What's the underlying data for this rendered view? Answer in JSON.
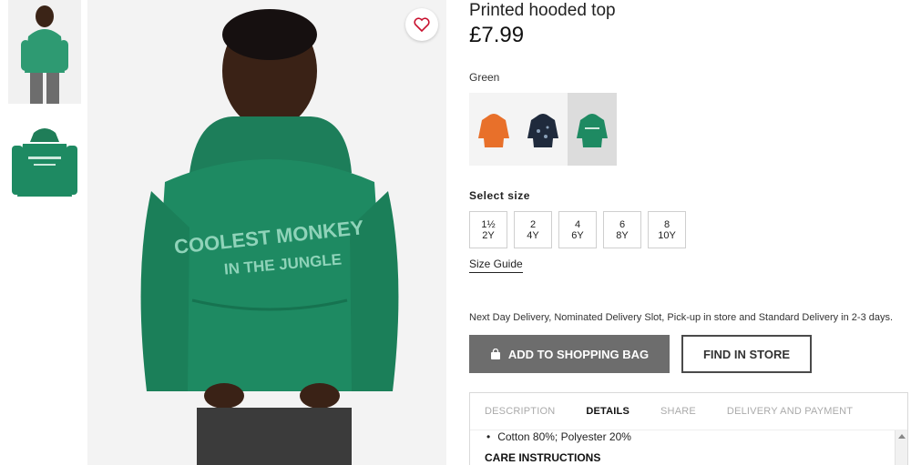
{
  "product": {
    "title": "Printed hooded top",
    "price": "£7.99",
    "color_name": "Green",
    "hoodie_print_line1": "COOLEST MONKEY",
    "hoodie_print_line2": "IN THE JUNGLE"
  },
  "colors": {
    "swatches": [
      {
        "name": "orange",
        "hex": "#e8702a"
      },
      {
        "name": "navy",
        "hex": "#1f2a3c"
      },
      {
        "name": "green",
        "hex": "#1f8a63",
        "selected": true
      }
    ],
    "hoodie_green": "#1e8a62",
    "button_grey": "#6d6d6d"
  },
  "sizes": {
    "label": "Select size",
    "options": [
      {
        "line1": "1½",
        "line2": "2Y"
      },
      {
        "line1": "2",
        "line2": "4Y"
      },
      {
        "line1": "4",
        "line2": "6Y"
      },
      {
        "line1": "6",
        "line2": "8Y"
      },
      {
        "line1": "8",
        "line2": "10Y"
      }
    ],
    "guide_label": "Size Guide"
  },
  "delivery_text": "Next Day Delivery, Nominated Delivery Slot, Pick-up in store and Standard Delivery in 2-3 days.",
  "actions": {
    "add_to_bag": "ADD TO SHOPPING BAG",
    "find_in_store": "FIND IN STORE"
  },
  "tabs": [
    {
      "label": "DESCRIPTION",
      "active": false
    },
    {
      "label": "DETAILS",
      "active": true
    },
    {
      "label": "SHARE",
      "active": false
    },
    {
      "label": "DELIVERY AND PAYMENT",
      "active": false
    }
  ],
  "details": {
    "composition": "Cotton 80%; Polyester 20%",
    "care_heading": "CARE INSTRUCTIONS"
  },
  "icons": [
    "heart-icon",
    "bag-icon"
  ]
}
